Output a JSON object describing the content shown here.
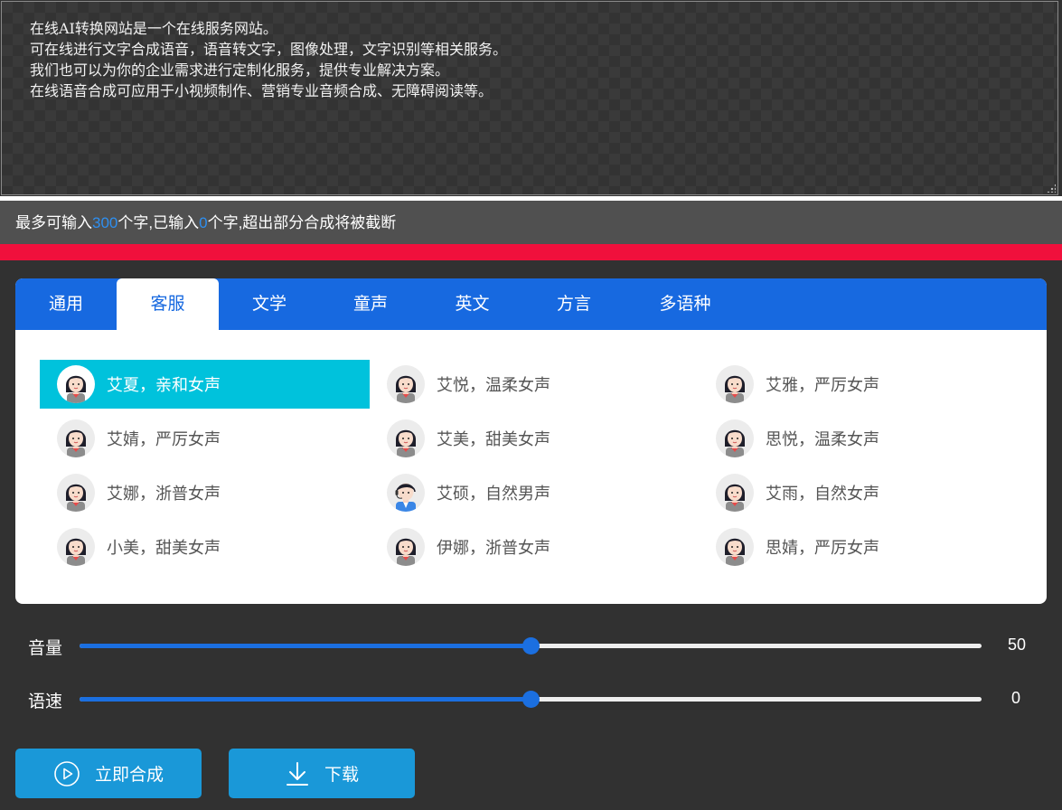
{
  "text_input": {
    "content": "在线AI转换网站是一个在线服务网站。\n可在线进行文字合成语音，语音转文字，图像处理，文字识别等相关服务。\n我们也可以为你的企业需求进行定制化服务，提供专业解决方案。\n在线语音合成可应用于小视频制作、营销专业音频合成、无障碍阅读等。"
  },
  "char_info": {
    "prefix": "最多可输入",
    "max": "300",
    "middle": "个字,已输入",
    "count": "0",
    "suffix": "个字,超出部分合成将被截断"
  },
  "tabs": [
    "通用",
    "客服",
    "文学",
    "童声",
    "英文",
    "方言",
    "多语种"
  ],
  "active_tab": "客服",
  "voices": [
    {
      "label": "艾夏，亲和女声",
      "gender": "female",
      "selected": true
    },
    {
      "label": "艾悦，温柔女声",
      "gender": "female",
      "selected": false
    },
    {
      "label": "艾雅，严厉女声",
      "gender": "female",
      "selected": false
    },
    {
      "label": "艾婧，严厉女声",
      "gender": "female",
      "selected": false
    },
    {
      "label": "艾美，甜美女声",
      "gender": "female",
      "selected": false
    },
    {
      "label": "思悦，温柔女声",
      "gender": "female",
      "selected": false
    },
    {
      "label": "艾娜，浙普女声",
      "gender": "female",
      "selected": false
    },
    {
      "label": "艾硕，自然男声",
      "gender": "male",
      "selected": false
    },
    {
      "label": "艾雨，自然女声",
      "gender": "female",
      "selected": false
    },
    {
      "label": "小美，甜美女声",
      "gender": "female",
      "selected": false
    },
    {
      "label": "伊娜，浙普女声",
      "gender": "female",
      "selected": false
    },
    {
      "label": "思婧，严厉女声",
      "gender": "female",
      "selected": false
    }
  ],
  "sliders": {
    "volume": {
      "label": "音量",
      "value": "50",
      "fraction": 0.5
    },
    "speed": {
      "label": "语速",
      "value": "0",
      "fraction": 0.5
    }
  },
  "buttons": {
    "synthesize": "立即合成",
    "download": "下载"
  },
  "colors": {
    "accent_blue": "#1769e0",
    "selected_cyan": "#00c2dc",
    "button_blue": "#1a98d8",
    "red_bar": "#f0103c"
  },
  "icons": {
    "synthesize": "play-circle-icon",
    "download": "download-icon"
  }
}
